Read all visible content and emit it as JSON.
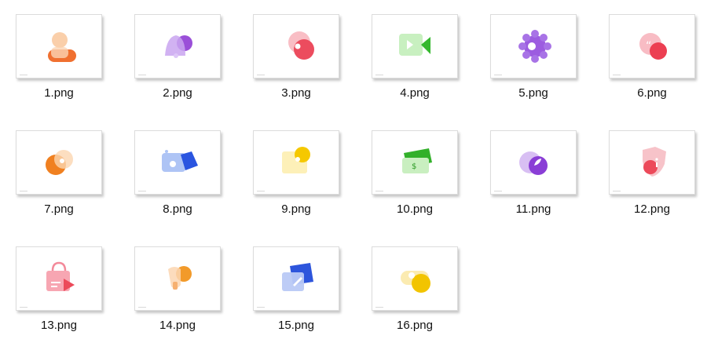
{
  "files": [
    {
      "name": "1.png",
      "icon": "user-icon"
    },
    {
      "name": "2.png",
      "icon": "bell-chat-icon"
    },
    {
      "name": "3.png",
      "icon": "chat-bubble-icon"
    },
    {
      "name": "4.png",
      "icon": "video-camera-icon"
    },
    {
      "name": "5.png",
      "icon": "gear-icon"
    },
    {
      "name": "6.png",
      "icon": "quote-bubble-icon"
    },
    {
      "name": "7.png",
      "icon": "clock-bubble-icon"
    },
    {
      "name": "8.png",
      "icon": "camera-icon"
    },
    {
      "name": "9.png",
      "icon": "note-icon"
    },
    {
      "name": "10.png",
      "icon": "money-icon"
    },
    {
      "name": "11.png",
      "icon": "leaf-icon"
    },
    {
      "name": "12.png",
      "icon": "shield-icon"
    },
    {
      "name": "13.png",
      "icon": "shopping-bag-icon"
    },
    {
      "name": "14.png",
      "icon": "lightbulb-icon"
    },
    {
      "name": "15.png",
      "icon": "edit-icon"
    },
    {
      "name": "16.png",
      "icon": "toggle-icon"
    }
  ]
}
